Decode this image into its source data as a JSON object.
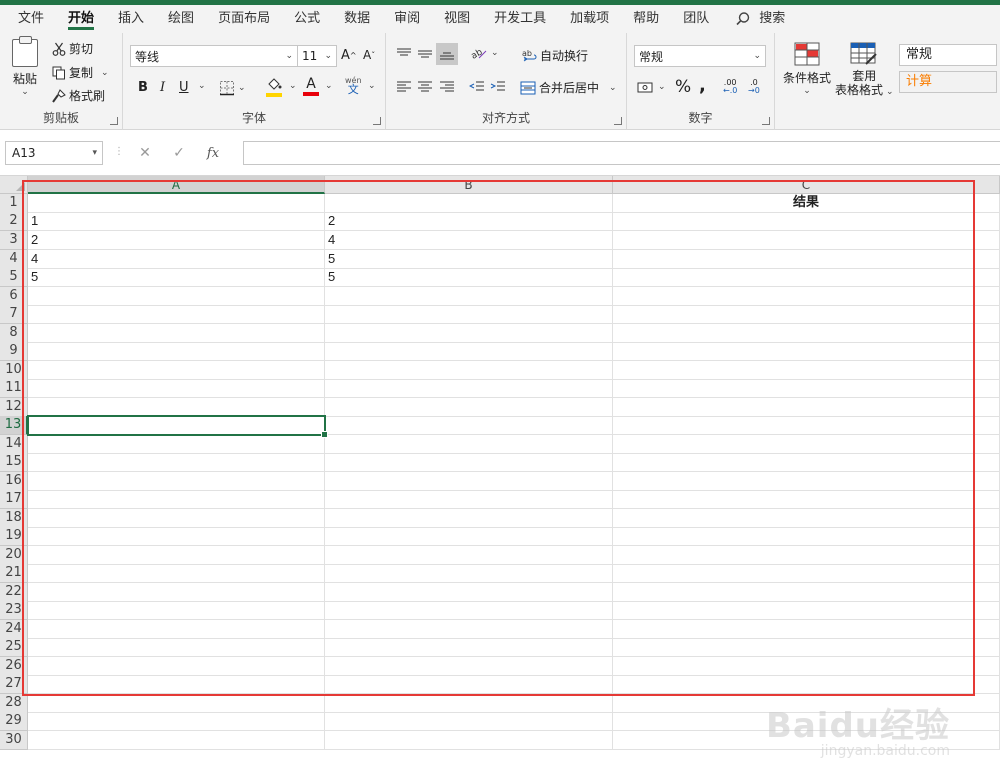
{
  "menu": {
    "tabs": [
      "文件",
      "开始",
      "插入",
      "绘图",
      "页面布局",
      "公式",
      "数据",
      "审阅",
      "视图",
      "开发工具",
      "加载项",
      "帮助",
      "团队"
    ],
    "active_tab": "开始",
    "search_label": "搜索"
  },
  "ribbon": {
    "clipboard": {
      "paste": "粘贴",
      "cut": "剪切",
      "copy": "复制",
      "format_painter": "格式刷",
      "label": "剪贴板"
    },
    "font": {
      "font_name": "等线",
      "font_size": "11",
      "bold": "B",
      "italic": "I",
      "underline": "U",
      "increase": "A",
      "decrease": "A",
      "font_color_letter": "A",
      "phonetic_top": "wén",
      "phonetic_bottom": "文",
      "label": "字体",
      "highlight_color": "#ffd400",
      "font_color": "#e8000a"
    },
    "alignment": {
      "wrap_text": "自动换行",
      "merge_center": "合并后居中",
      "label": "对齐方式"
    },
    "number": {
      "format": "常规",
      "percent": "%",
      "comma": ",",
      "inc_decimal": ".00",
      "dec_decimal": ".0",
      "label": "数字"
    },
    "styles": {
      "conditional_format": "条件格式",
      "table_format_line1": "套用",
      "table_format_line2": "表格格式",
      "style_normal": "常规",
      "style_calc": "计算",
      "calc_color": "#fa7d00"
    }
  },
  "formula_bar": {
    "name_box": "A13",
    "cancel": "✕",
    "enter": "✓",
    "fx": "fx",
    "value": ""
  },
  "sheet": {
    "columns": [
      "A",
      "B",
      "C"
    ],
    "row_count": 30,
    "selected_row": "13",
    "selected_col": "A",
    "cells": {
      "C1": "结果",
      "A2": "1",
      "B2": "2",
      "A3": "2",
      "B3": "4",
      "A4": "4",
      "B4": "5",
      "A5": "5",
      "B5": "5"
    }
  },
  "watermark": {
    "main": "Baidu经验",
    "sub": "jingyan.baidu.com"
  },
  "colors": {
    "accent": "#217346",
    "annotation": "#e53935"
  }
}
